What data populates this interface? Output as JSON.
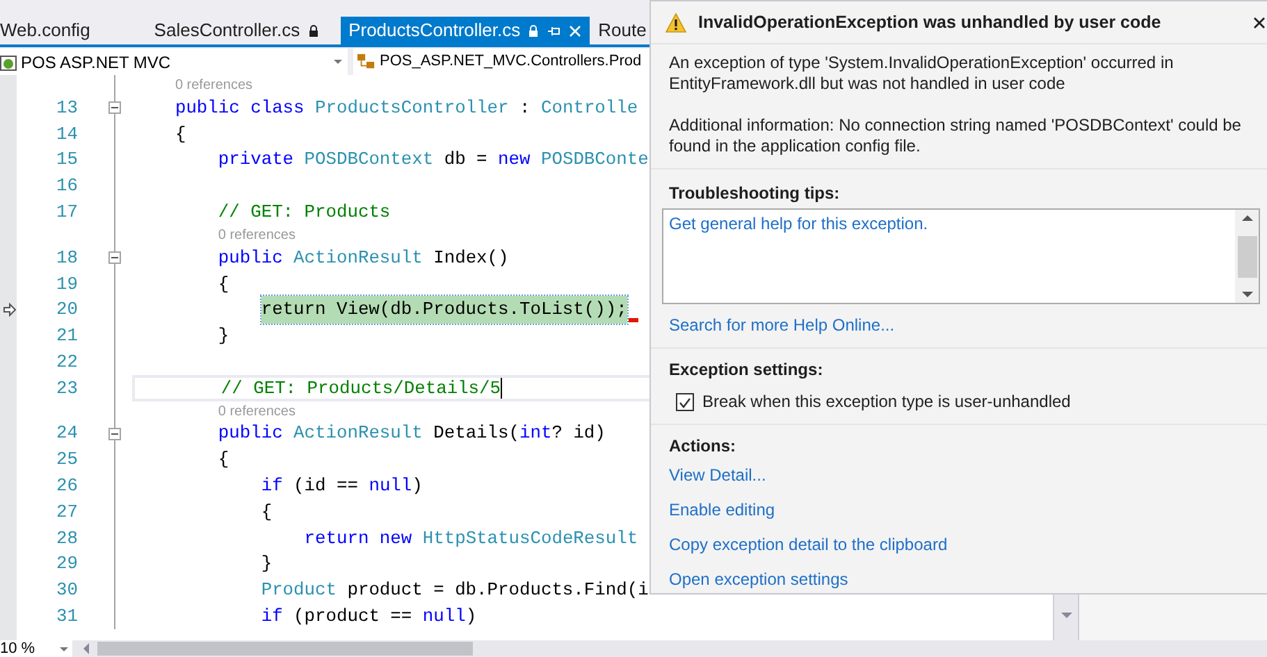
{
  "tabs": [
    {
      "label": "Web.config",
      "selected": false,
      "locked": false,
      "pinnable": false
    },
    {
      "label": "SalesController.cs",
      "selected": false,
      "locked": true,
      "pinnable": false
    },
    {
      "label": "ProductsController.cs",
      "selected": true,
      "locked": true,
      "pinnable": true
    },
    {
      "label": "Route",
      "selected": false,
      "locked": false,
      "pinnable": false
    }
  ],
  "navigation_bar": {
    "project": "POS ASP.NET MVC",
    "type": "POS_ASP.NET_MVC.Controllers.Prod"
  },
  "editor": {
    "lines": [
      {
        "number": "13",
        "lens": "0 references",
        "fold": true,
        "execution": false,
        "cursor": false,
        "tokens": [
          {
            "kind": "keyword",
            "text": "    public class "
          },
          {
            "kind": "type",
            "text": "ProductsController"
          },
          {
            "kind": "plain",
            "text": " : "
          },
          {
            "kind": "type",
            "text": "Controlle"
          }
        ]
      },
      {
        "number": "14",
        "fold": false,
        "execution": false,
        "cursor": false,
        "tokens": [
          {
            "kind": "plain",
            "text": "    {"
          }
        ]
      },
      {
        "number": "15",
        "fold": false,
        "execution": false,
        "cursor": false,
        "tokens": [
          {
            "kind": "keyword",
            "text": "        private "
          },
          {
            "kind": "type",
            "text": "POSDBContext"
          },
          {
            "kind": "plain",
            "text": " db = "
          },
          {
            "kind": "keyword",
            "text": "new "
          },
          {
            "kind": "type",
            "text": "POSDBConte"
          }
        ]
      },
      {
        "number": "16",
        "fold": false,
        "execution": false,
        "cursor": false
      },
      {
        "number": "17",
        "fold": false,
        "execution": false,
        "cursor": false,
        "tokens": [
          {
            "kind": "comment",
            "text": "        // GET: Products"
          }
        ]
      },
      {
        "number": "18",
        "lens": "0 references",
        "fold": true,
        "execution": false,
        "cursor": false,
        "tokens": [
          {
            "kind": "keyword",
            "text": "        public "
          },
          {
            "kind": "type",
            "text": "ActionResult"
          },
          {
            "kind": "plain",
            "text": " Index()"
          }
        ]
      },
      {
        "number": "19",
        "fold": false,
        "execution": false,
        "cursor": false,
        "tokens": [
          {
            "kind": "plain",
            "text": "        {"
          }
        ]
      },
      {
        "number": "20",
        "fold": false,
        "execution": true,
        "cursor": false,
        "tokens": [
          {
            "kind": "plain",
            "text": "            return View(db.Products.ToList());"
          }
        ]
      },
      {
        "number": "21",
        "fold": false,
        "execution": false,
        "cursor": false,
        "tokens": [
          {
            "kind": "plain",
            "text": "        }"
          }
        ]
      },
      {
        "number": "22",
        "fold": false,
        "execution": false,
        "cursor": false
      },
      {
        "number": "23",
        "fold": false,
        "execution": false,
        "cursor": true,
        "tokens": [
          {
            "kind": "comment",
            "text": "        // GET: Products/Details/5"
          }
        ]
      },
      {
        "number": "24",
        "lens": "0 references",
        "fold": true,
        "execution": false,
        "cursor": false,
        "tokens": [
          {
            "kind": "keyword",
            "text": "        public "
          },
          {
            "kind": "type",
            "text": "ActionResult"
          },
          {
            "kind": "plain",
            "text": " Details("
          },
          {
            "kind": "keyword",
            "text": "int"
          },
          {
            "kind": "plain",
            "text": "? id)"
          }
        ]
      },
      {
        "number": "25",
        "fold": false,
        "execution": false,
        "cursor": false,
        "tokens": [
          {
            "kind": "plain",
            "text": "        {"
          }
        ]
      },
      {
        "number": "26",
        "fold": false,
        "execution": false,
        "cursor": false,
        "tokens": [
          {
            "kind": "keyword",
            "text": "            if"
          },
          {
            "kind": "plain",
            "text": " (id == "
          },
          {
            "kind": "keyword",
            "text": "null"
          },
          {
            "kind": "plain",
            "text": ")"
          }
        ]
      },
      {
        "number": "27",
        "fold": false,
        "execution": false,
        "cursor": false,
        "tokens": [
          {
            "kind": "plain",
            "text": "            {"
          }
        ]
      },
      {
        "number": "28",
        "fold": false,
        "execution": false,
        "cursor": false,
        "tokens": [
          {
            "kind": "keyword",
            "text": "                return new "
          },
          {
            "kind": "type",
            "text": "HttpStatusCodeResult"
          }
        ]
      },
      {
        "number": "29",
        "fold": false,
        "execution": false,
        "cursor": false,
        "tokens": [
          {
            "kind": "plain",
            "text": "            }"
          }
        ]
      },
      {
        "number": "30",
        "fold": false,
        "execution": false,
        "cursor": false,
        "tokens": [
          {
            "kind": "type",
            "text": "            Product"
          },
          {
            "kind": "plain",
            "text": " product = db.Products.Find(i"
          }
        ]
      },
      {
        "number": "31",
        "fold": false,
        "execution": false,
        "cursor": false,
        "tokens": [
          {
            "kind": "keyword",
            "text": "            if"
          },
          {
            "kind": "plain",
            "text": " (product == "
          },
          {
            "kind": "keyword",
            "text": "null"
          },
          {
            "kind": "plain",
            "text": ")"
          }
        ]
      }
    ]
  },
  "zoom": "10 %",
  "exception_popup": {
    "title": "InvalidOperationException was unhandled by user code",
    "message": "An exception of type 'System.InvalidOperationException' occurred in EntityFramework.dll but was not handled in user code",
    "additional_information": "Additional information: No connection string named 'POSDBContext' could be found in the application config file.",
    "troubleshooting_heading": "Troubleshooting tips:",
    "tips": [
      "Get general help for this exception."
    ],
    "search_link": "Search for more Help Online...",
    "settings_heading": "Exception settings:",
    "break_option": {
      "label": "Break when this exception type is user-unhandled",
      "checked": true
    },
    "actions_heading": "Actions:",
    "actions": [
      "View Detail...",
      "Enable editing",
      "Copy exception detail to the clipboard",
      "Open exception settings"
    ]
  }
}
